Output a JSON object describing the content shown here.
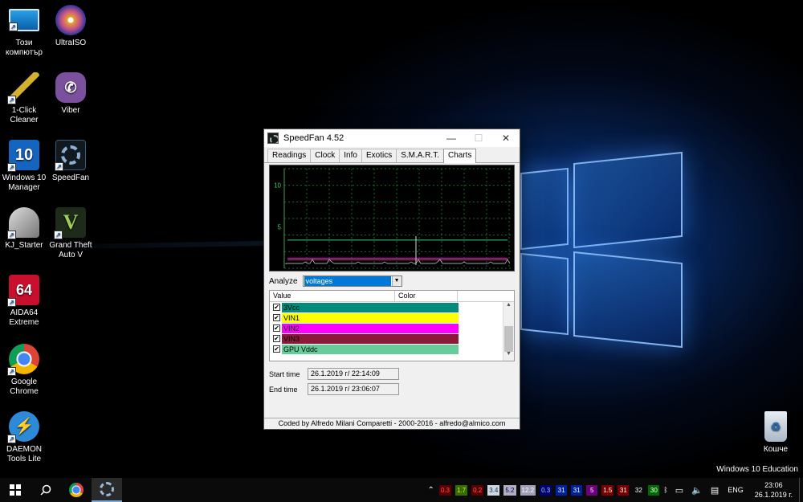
{
  "desktop": {
    "icons": [
      {
        "label": "Този компютър",
        "icon": "this-pc-icon"
      },
      {
        "label": "UltraISO",
        "icon": "disc-icon"
      },
      {
        "label": "1-Click Cleaner",
        "icon": "broom-icon"
      },
      {
        "label": "Viber",
        "icon": "viber-icon"
      },
      {
        "label": "Windows 10 Manager",
        "icon": "win10-manager-icon"
      },
      {
        "label": "SpeedFan",
        "icon": "fan-icon"
      },
      {
        "label": "KJ_Starter",
        "icon": "kj-starter-icon"
      },
      {
        "label": "Grand Theft Auto V",
        "icon": "gta-icon"
      },
      {
        "label": "AIDA64 Extreme",
        "icon": "aida64-icon"
      },
      {
        "label": "Google Chrome",
        "icon": "chrome-icon"
      },
      {
        "label": "DAEMON Tools Lite",
        "icon": "daemon-icon"
      },
      {
        "label": "Кошче",
        "icon": "recycle-bin-icon"
      }
    ],
    "aida_badge": "64",
    "win10_badge": "10",
    "watermark": "Windows 10 Education"
  },
  "window": {
    "title": "SpeedFan 4.52",
    "tabs": [
      "Readings",
      "Clock",
      "Info",
      "Exotics",
      "S.M.A.R.T.",
      "Charts"
    ],
    "active_tab": "Charts",
    "analyze_label": "Analyze",
    "analyze_value": "voltages",
    "columns": [
      "Value",
      "Color"
    ],
    "rows": [
      {
        "name": "3Vcc",
        "color": "#008b7a"
      },
      {
        "name": "VIN1",
        "color": "#ffff00"
      },
      {
        "name": "VIN2",
        "color": "#ff00ff"
      },
      {
        "name": "VIN3",
        "color": "#8b1a3a"
      },
      {
        "name": "GPU Vddc",
        "color": "#66cc99"
      }
    ],
    "start_label": "Start time",
    "start_value": "26.1.2019 г/ 22:14:09",
    "end_label": "End time",
    "end_value": "26.1.2019 г/ 23:06:07",
    "footer": "Coded by Alfredo Milani Comparetti - 2000-2016 - alfredo@almico.com"
  },
  "chart_data": {
    "type": "line",
    "ytick_labels": [
      "10",
      "5"
    ],
    "series": [
      {
        "color": "#3ad070",
        "values": [
          3.4,
          3.4,
          3.4,
          3.4,
          3.4,
          3.4,
          3.4,
          3.4
        ]
      },
      {
        "color": "#ff00ff",
        "values": [
          1.2,
          1.2,
          1.2,
          1.2,
          1.2,
          1.2,
          1.2,
          1.2
        ]
      },
      {
        "color": "#cc3366",
        "values": [
          1.0,
          1.0,
          1.0,
          1.0,
          1.0,
          1.0,
          1.0,
          1.0
        ]
      }
    ],
    "ylim": [
      0,
      12
    ]
  },
  "taskbar": {
    "language": "ENG",
    "time": "23:06",
    "date": "26.1.2019 г.",
    "tray_badges": [
      {
        "text": "0.3",
        "bg": "#5a0000",
        "fg": "#ff5050"
      },
      {
        "text": "1.7",
        "bg": "#3a6a00",
        "fg": "#b0ff40"
      },
      {
        "text": "0.2",
        "bg": "#5a0000",
        "fg": "#ff6060"
      },
      {
        "text": "3.4",
        "bg": "#cfd8e0",
        "fg": "#003050"
      },
      {
        "text": "5.2",
        "bg": "#b0b0c0",
        "fg": "#000060"
      },
      {
        "text": "12.2",
        "bg": "#a0a0b8",
        "fg": "#fff"
      },
      {
        "text": "0.3",
        "bg": "#000070",
        "fg": "#9cf"
      },
      {
        "text": "31",
        "bg": "#0020a0",
        "fg": "#fff"
      },
      {
        "text": "31",
        "bg": "#0020a0",
        "fg": "#fff"
      },
      {
        "text": "5",
        "bg": "#6a007a",
        "fg": "#fff"
      },
      {
        "text": "1.5",
        "bg": "#7a0000",
        "fg": "#fff"
      },
      {
        "text": "31",
        "bg": "#7a0000",
        "fg": "#fff"
      },
      {
        "text": "32",
        "bg": "#0a0a0a",
        "fg": "#fff"
      },
      {
        "text": "30",
        "bg": "#006a00",
        "fg": "#fff"
      }
    ]
  }
}
